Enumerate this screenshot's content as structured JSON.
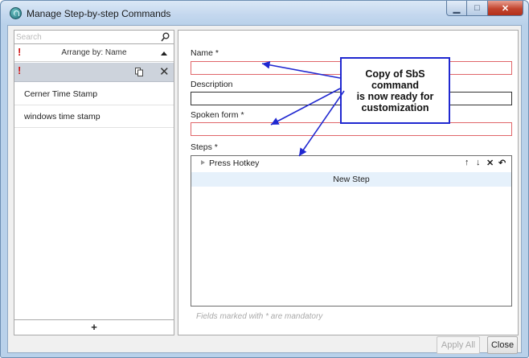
{
  "window": {
    "title": "Manage Step-by-step Commands",
    "min_glyph": "▁",
    "max_glyph": "□",
    "close_glyph": "✕"
  },
  "left_panel": {
    "search_placeholder": "Search",
    "arrange_label": "Arrange by: Name",
    "required_mark": "!",
    "delete_glyph": "✕",
    "items": [
      {
        "label": "Cerner Time Stamp"
      },
      {
        "label": "windows time stamp"
      }
    ],
    "add_label": "+"
  },
  "form": {
    "name_label": "Name *",
    "name_value": "",
    "description_label": "Description",
    "description_value": "",
    "spoken_label": "Spoken form *",
    "spoken_value": "",
    "steps_label": "Steps *",
    "steps": [
      {
        "label": "Press Hotkey"
      }
    ],
    "step_tools": {
      "up": "↑",
      "down": "↓",
      "delete": "✕",
      "undo": "↶"
    },
    "new_step_label": "New Step",
    "mandatory_note": "Fields marked with * are mandatory"
  },
  "callout": {
    "lines": [
      "Copy of SbS command",
      "is now ready for",
      "customization"
    ],
    "border_color": "#2028d0"
  },
  "footer": {
    "apply_all_label": "Apply All",
    "close_label": "Close"
  },
  "colors": {
    "required_border": "#e0666a",
    "selected_row": "#cdd3dc",
    "new_step_bg": "#e6f1fb",
    "required_mark": "#d21a1a"
  },
  "icons": {
    "search": "search-icon",
    "sort": "sort-ascending-icon",
    "copy": "copy-icon",
    "delete": "close-icon",
    "add": "plus-icon",
    "expand": "chevron-right-icon"
  }
}
